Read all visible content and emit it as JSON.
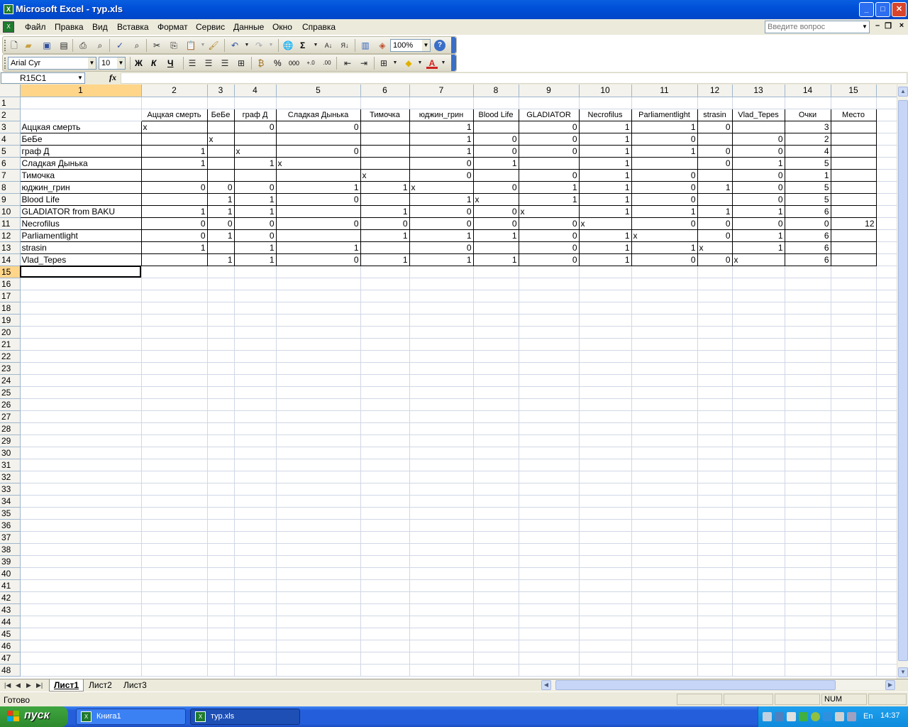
{
  "window": {
    "title": "Microsoft Excel - тур.xls",
    "app_icon": "excel-icon",
    "minimize": "_",
    "maximize": "□",
    "close": "✕"
  },
  "menubar": {
    "items": [
      "Файл",
      "Правка",
      "Вид",
      "Вставка",
      "Формат",
      "Сервис",
      "Данные",
      "Окно",
      "Справка"
    ],
    "help_placeholder": "Введите вопрос"
  },
  "toolbar_standard": {
    "zoom": "100%",
    "sigma": "Σ"
  },
  "toolbar_formatting": {
    "font": "Arial Cyr",
    "size": "10",
    "bold": "Ж",
    "italic": "К",
    "underline": "Ч",
    "percent": "%",
    "thousands": "000"
  },
  "formula_bar": {
    "name_box": "R15C1",
    "fx": "fx",
    "content": ""
  },
  "columns": [
    "1",
    "2",
    "3",
    "4",
    "5",
    "6",
    "7",
    "8",
    "9",
    "10",
    "11",
    "12",
    "13",
    "14",
    "15"
  ],
  "row_numbers": [
    "1",
    "2",
    "3",
    "4",
    "5",
    "6",
    "7",
    "8",
    "9",
    "10",
    "11",
    "12",
    "13",
    "14",
    "15",
    "16",
    "17",
    "18",
    "19",
    "20",
    "21",
    "22",
    "23",
    "24",
    "25",
    "26",
    "27",
    "28",
    "29",
    "30",
    "31",
    "32",
    "33",
    "34",
    "35",
    "36",
    "37",
    "38",
    "39",
    "40",
    "41",
    "42",
    "43",
    "44",
    "45",
    "46",
    "47",
    "48"
  ],
  "table": {
    "headers": [
      "Аццкая смерть",
      "БеБе",
      "граф Д",
      "Сладкая Дынька",
      "Тимочка",
      "юджин_грин",
      "Blood Life",
      "GLADIATOR",
      "Necrofilus",
      "Parliamentlight",
      "strasin",
      "Vlad_Tepes",
      "Очки",
      "Место"
    ],
    "rows": [
      [
        "Аццкая смерть",
        "x",
        "",
        "0",
        "0",
        "",
        "1",
        "",
        "0",
        "1",
        "1",
        "0",
        "",
        "3",
        ""
      ],
      [
        "БеБе",
        "",
        "x",
        "",
        "",
        "",
        "1",
        "0",
        "0",
        "1",
        "0",
        "",
        "0",
        "2",
        ""
      ],
      [
        "   граф Д",
        "1",
        "",
        "x",
        "0",
        "",
        "1",
        "0",
        "0",
        "1",
        "1",
        "0",
        "0",
        "4",
        ""
      ],
      [
        "   Сладкая Дынька",
        "1",
        "",
        "1",
        "x",
        "",
        "0",
        "1",
        "",
        "1",
        "",
        "0",
        "1",
        "5",
        ""
      ],
      [
        "   Тимочка",
        "",
        "",
        "",
        "",
        "x",
        "0",
        "",
        "0",
        "1",
        "0",
        "",
        "0",
        "1",
        ""
      ],
      [
        "   юджин_грин",
        "0",
        "0",
        "0",
        "1",
        "1",
        "x",
        "0",
        "1",
        "1",
        "0",
        "1",
        "0",
        "5",
        ""
      ],
      [
        "Blood Life",
        "",
        "1",
        "1",
        "0",
        "",
        "1",
        "x",
        "1",
        "1",
        "0",
        "",
        "0",
        "5",
        ""
      ],
      [
        "   GLADIATOR from BAKU",
        "1",
        "1",
        "1",
        "",
        "1",
        "0",
        "0",
        "x",
        "1",
        "1",
        "1",
        "1",
        "6",
        ""
      ],
      [
        "   Necrofilus",
        "0",
        "0",
        "0",
        "0",
        "0",
        "0",
        "0",
        "0",
        "x",
        "0",
        "0",
        "0",
        "0",
        "12"
      ],
      [
        "Parliamentlight",
        "0",
        "1",
        "0",
        "",
        "1",
        "1",
        "1",
        "0",
        "1",
        "x",
        "0",
        "1",
        "6",
        ""
      ],
      [
        "strasin",
        "1",
        "",
        "1",
        "1",
        "",
        "0",
        "",
        "0",
        "1",
        "1",
        "x",
        "1",
        "6",
        ""
      ],
      [
        "Vlad_Tepes",
        "",
        "1",
        "1",
        "0",
        "1",
        "1",
        "1",
        "0",
        "1",
        "0",
        "0",
        "x",
        "6",
        ""
      ]
    ]
  },
  "sheets": {
    "tabs": [
      "Лист1",
      "Лист2",
      "Лист3"
    ],
    "active": "Лист1"
  },
  "status": {
    "text": "Готово",
    "num": "NUM"
  },
  "taskbar": {
    "start": "пуск",
    "buttons": [
      "Книга1",
      "тур.xls"
    ],
    "active": "тур.xls",
    "lang": "En",
    "clock": "14:37"
  }
}
